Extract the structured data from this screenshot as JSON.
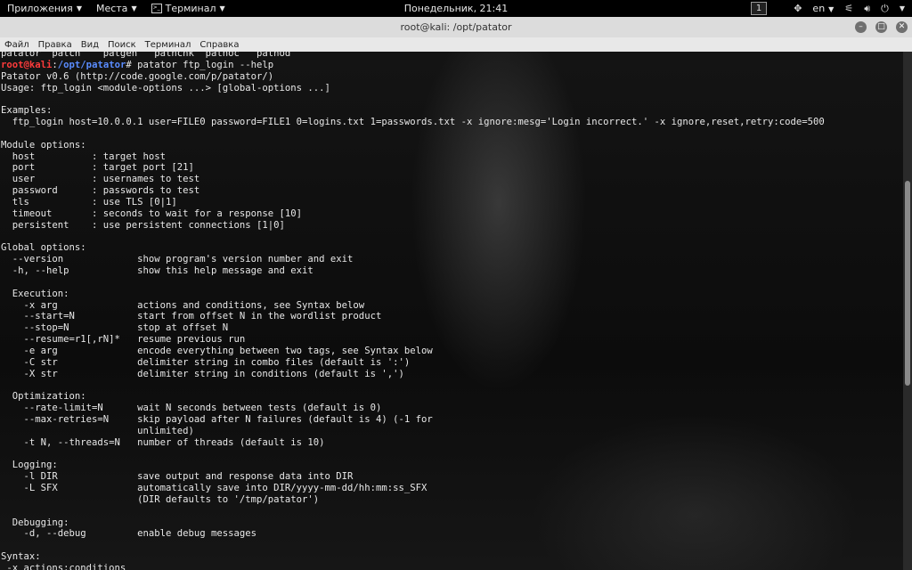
{
  "topbar": {
    "apps_label": "Приложения",
    "places_label": "Места",
    "terminal_label": "Терминал",
    "clock": "Понедельник, 21:41",
    "workspace": "1",
    "lang": "en"
  },
  "window": {
    "title": "root@kali: /opt/patator"
  },
  "menubar": {
    "items": [
      "Файл",
      "Правка",
      "Вид",
      "Поиск",
      "Терминал",
      "Справка"
    ]
  },
  "terminal": {
    "prev_line": "patator  patch    patgen   pathchk  pathoc   pathod",
    "prompt_user": "root@kali",
    "prompt_sep": ":",
    "prompt_path": "/opt/patator",
    "command": "# patator ftp_login --help",
    "output": "Patator v0.6 (http://code.google.com/p/patator/)\nUsage: ftp_login <module-options ...> [global-options ...]\n\nExamples:\n  ftp_login host=10.0.0.1 user=FILE0 password=FILE1 0=logins.txt 1=passwords.txt -x ignore:mesg='Login incorrect.' -x ignore,reset,retry:code=500\n\nModule options:\n  host          : target host\n  port          : target port [21]\n  user          : usernames to test\n  password      : passwords to test\n  tls           : use TLS [0|1]\n  timeout       : seconds to wait for a response [10]\n  persistent    : use persistent connections [1|0]\n\nGlobal options:\n  --version             show program's version number and exit\n  -h, --help            show this help message and exit\n\n  Execution:\n    -x arg              actions and conditions, see Syntax below\n    --start=N           start from offset N in the wordlist product\n    --stop=N            stop at offset N\n    --resume=r1[,rN]*   resume previous run\n    -e arg              encode everything between two tags, see Syntax below\n    -C str              delimiter string in combo files (default is ':')\n    -X str              delimiter string in conditions (default is ',')\n\n  Optimization:\n    --rate-limit=N      wait N seconds between tests (default is 0)\n    --max-retries=N     skip payload after N failures (default is 4) (-1 for\n                        unlimited)\n    -t N, --threads=N   number of threads (default is 10)\n\n  Logging:\n    -l DIR              save output and response data into DIR\n    -L SFX              automatically save into DIR/yyyy-mm-dd/hh:mm:ss_SFX\n                        (DIR defaults to '/tmp/patator')\n\n  Debugging:\n    -d, --debug         enable debug messages\n\nSyntax:\n -x actions:conditions"
  },
  "colors": {
    "prompt_user": "#ff3b3b",
    "prompt_path": "#5a8cff",
    "terminal_text": "#e8e8e8",
    "titlebar": "#dcdcdc"
  },
  "icons": {
    "terminal": "terminal-icon",
    "network": "network-icon",
    "volume": "volume-icon",
    "power": "power-icon",
    "accessibility": "accessibility-icon",
    "minimize": "minimize-icon",
    "maximize": "maximize-icon",
    "close": "close-icon"
  }
}
